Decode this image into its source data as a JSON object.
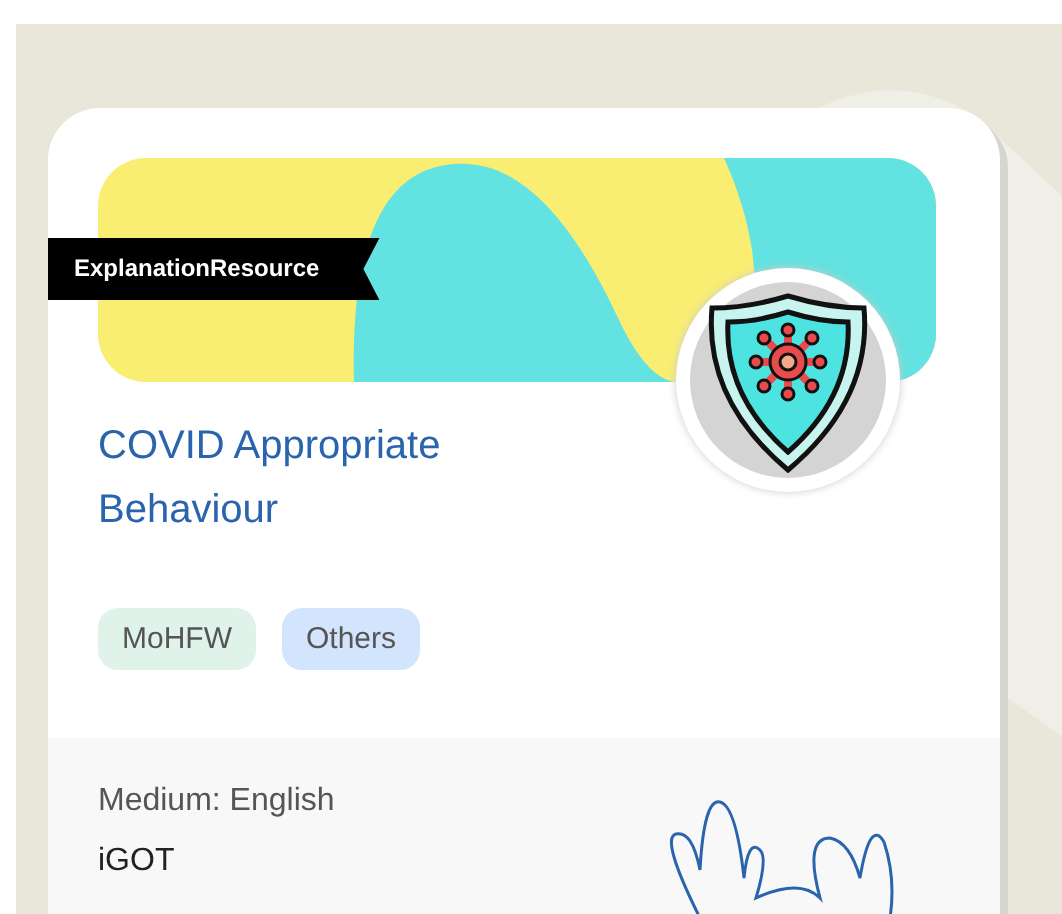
{
  "card": {
    "ribbon": "ExplanationResource",
    "title": "COVID Appropriate Behaviour",
    "tags": [
      {
        "label": "MoHFW",
        "color": "#e0f3ea"
      },
      {
        "label": "Others",
        "color": "#d2e5fc"
      }
    ],
    "medium": "Medium: English",
    "provider": "iGOT"
  }
}
